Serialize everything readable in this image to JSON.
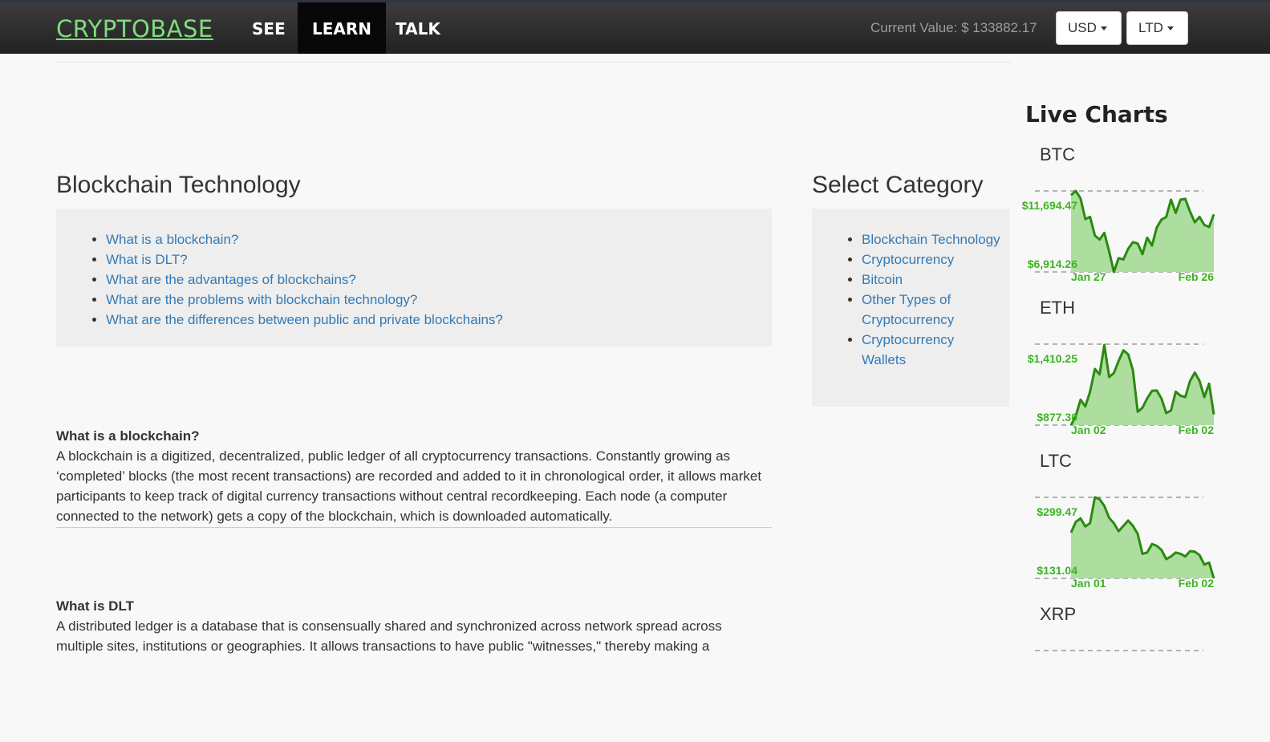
{
  "nav": {
    "logo": "CRYPTOBASE",
    "items": [
      "SEE",
      "LEARN",
      "TALK"
    ],
    "active": "LEARN",
    "current_value": "Current Value: $ 133882.17",
    "currency_btn": "USD",
    "coin_btn": "LTD"
  },
  "main": {
    "title": "Blockchain Technology",
    "toc": [
      "What is a blockchain?",
      "What is DLT?",
      "What are the advantages of blockchains?",
      "What are the problems with blockchain technology?",
      "What are the differences between public and private blockchains?"
    ],
    "sections": [
      {
        "heading": "What is a blockchain?",
        "text": "A blockchain is a digitized, decentralized, public ledger of all cryptocurrency transactions. Constantly growing as ‘completed’ blocks (the most recent transactions) are recorded and added to it in chronological order, it allows market participants to keep track of digital currency transactions without central recordkeeping. Each node (a computer connected to the network) gets a copy of the blockchain, which is downloaded automatically."
      },
      {
        "heading": "What is DLT",
        "text": "A distributed ledger is a database that is consensually shared and synchronized across network spread across multiple sites, institutions or geographies. It allows transactions to have public \"witnesses,\" thereby making a"
      }
    ]
  },
  "category": {
    "title": "Select Category",
    "items": [
      "Blockchain Technology",
      "Cryptocurrency",
      "Bitcoin",
      "Other Types of Cryptocurrency",
      "Cryptocurrency Wallets"
    ]
  },
  "live": {
    "title": "Live Charts"
  },
  "chart_data": [
    {
      "type": "area",
      "name": "BTC",
      "max_label": "$11,694.47",
      "min_label": "$6,914.26",
      "x_start": "Jan 27",
      "x_end": "Feb 26",
      "ylim": [
        6914.26,
        11694.47
      ],
      "values": [
        11444,
        11694,
        11255,
        10031,
        10159,
        9061,
        8826,
        9218,
        8119,
        6914,
        7727,
        7651,
        8277,
        8670,
        8591,
        7965,
        8936,
        8466,
        9533,
        10002,
        10159,
        11178,
        10394,
        11178,
        11225,
        10472,
        9845,
        10159,
        9688,
        9563,
        10312
      ]
    },
    {
      "type": "area",
      "name": "ETH",
      "max_label": "$1,410.25",
      "min_label": "$877.30",
      "x_start": "Jan 02",
      "x_end": "Feb 02",
      "ylim": [
        877.3,
        1410.25
      ],
      "values": [
        877.3,
        938.9,
        1044.4,
        1000.4,
        1097.2,
        1246.6,
        1211.5,
        1405,
        1193.9,
        1220.4,
        1299.5,
        1369.8,
        1343.5,
        1238,
        965.3,
        991.6,
        1053.2,
        1102.5,
        1106,
        1053.2,
        956.4,
        974,
        1097.2,
        1070.8,
        1062,
        1167.5,
        1223.7,
        1167.5,
        1062,
        1149.9,
        947.6
      ]
    },
    {
      "type": "area",
      "name": "LTC",
      "max_label": "$299.47",
      "min_label": "$131.04",
      "x_start": "Jan 01",
      "x_end": "Feb 02",
      "ylim": [
        131.04,
        299.47
      ],
      "values": [
        226.3,
        248.5,
        255.7,
        239,
        245.7,
        299.47,
        295.6,
        281.7,
        256.8,
        245.7,
        229.1,
        240.2,
        251.3,
        240.2,
        223.5,
        182,
        184.8,
        202.5,
        198.6,
        190.3,
        171,
        176.5,
        184.8,
        182,
        176.5,
        187.6,
        186.4,
        179.2,
        159.8,
        163.7,
        131.04
      ]
    },
    {
      "type": "area",
      "name": "XRP",
      "values": []
    }
  ]
}
